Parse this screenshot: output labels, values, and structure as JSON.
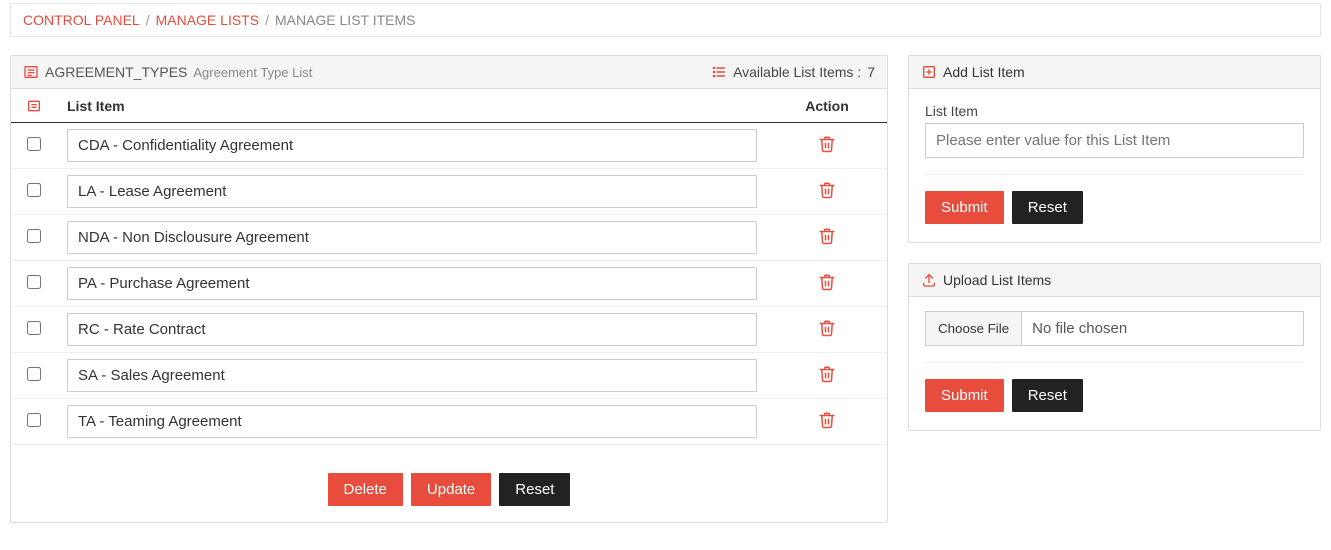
{
  "breadcrumb": {
    "items": [
      "CONTROL PANEL",
      "MANAGE LISTS",
      "MANAGE LIST ITEMS"
    ]
  },
  "left_panel": {
    "code": "AGREEMENT_TYPES",
    "desc": "Agreement Type List",
    "available_label": "Available List Items :",
    "available_count": "7",
    "columns": {
      "item": "List Item",
      "action": "Action"
    },
    "items": [
      {
        "value": "CDA - Confidentiality Agreement"
      },
      {
        "value": "LA - Lease Agreement"
      },
      {
        "value": "NDA - Non Disclousure Agreement"
      },
      {
        "value": "PA - Purchase Agreement"
      },
      {
        "value": "RC - Rate Contract"
      },
      {
        "value": "SA - Sales Agreement"
      },
      {
        "value": "TA - Teaming Agreement"
      }
    ],
    "buttons": {
      "delete": "Delete",
      "update": "Update",
      "reset": "Reset"
    }
  },
  "add_panel": {
    "title": "Add List Item",
    "field_label": "List Item",
    "placeholder": "Please enter value for this List Item",
    "submit": "Submit",
    "reset": "Reset"
  },
  "upload_panel": {
    "title": "Upload List Items",
    "choose": "Choose File",
    "no_file": "No file chosen",
    "submit": "Submit",
    "reset": "Reset"
  },
  "colors": {
    "accent": "#e74c3c"
  }
}
